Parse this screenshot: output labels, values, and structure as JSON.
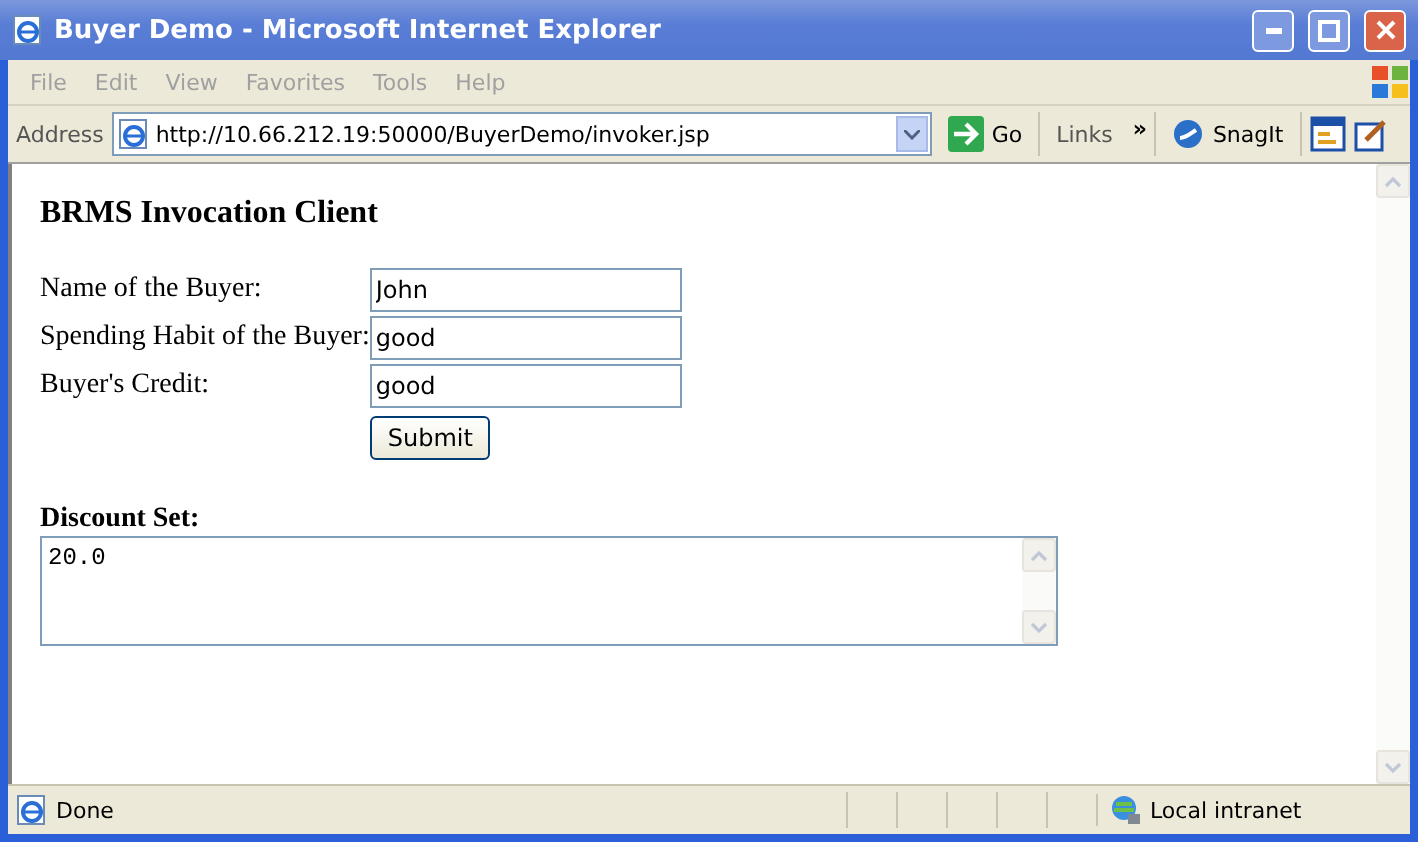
{
  "window": {
    "title": "Buyer Demo - Microsoft Internet Explorer"
  },
  "menu": [
    "File",
    "Edit",
    "View",
    "Favorites",
    "Tools",
    "Help"
  ],
  "address_bar": {
    "label": "Address",
    "url": "http://10.66.212.19:50000/BuyerDemo/invoker.jsp",
    "go": "Go",
    "links": "Links",
    "chevron": "»",
    "snagit": "SnagIt"
  },
  "page": {
    "heading": "BRMS Invocation Client",
    "fields": [
      {
        "label": "Name of the Buyer:",
        "value": "John"
      },
      {
        "label": "Spending Habit of the Buyer:",
        "value": "good"
      },
      {
        "label": "Buyer's Credit:",
        "value": "good"
      }
    ],
    "submit": "Submit",
    "result_label": "Discount Set:",
    "result_value": "20.0"
  },
  "status_bar": {
    "text": "Done",
    "zone": "Local intranet"
  }
}
